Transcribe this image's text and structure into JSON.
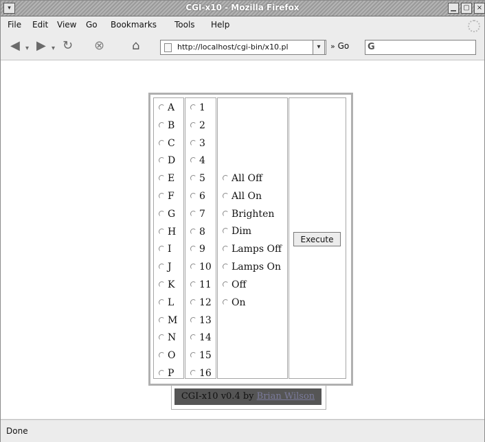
{
  "window": {
    "title": "CGI-x10 - Mozilla Firefox"
  },
  "menubar": {
    "items": [
      {
        "label": "File"
      },
      {
        "label": "Edit"
      },
      {
        "label": "View"
      },
      {
        "label": "Go"
      },
      {
        "label": "Bookmarks"
      },
      {
        "label": "Tools"
      },
      {
        "label": "Help"
      }
    ]
  },
  "navbar": {
    "url": "http://localhost/cgi-bin/x10.pl",
    "go_label": "Go",
    "icons": [
      "back-icon",
      "forward-icon",
      "reload-icon",
      "stop-icon",
      "home-icon"
    ]
  },
  "form": {
    "house_codes": [
      "A",
      "B",
      "C",
      "D",
      "E",
      "F",
      "G",
      "H",
      "I",
      "J",
      "K",
      "L",
      "M",
      "N",
      "O",
      "P"
    ],
    "unit_codes": [
      "1",
      "2",
      "3",
      "4",
      "5",
      "6",
      "7",
      "8",
      "9",
      "10",
      "11",
      "12",
      "13",
      "14",
      "15",
      "16"
    ],
    "commands": [
      "All Off",
      "All On",
      "Brighten",
      "Dim",
      "Lamps Off",
      "Lamps On",
      "Off",
      "On"
    ],
    "execute_label": "Execute"
  },
  "footer": {
    "prefix": "CGI-x10 v0.4 by ",
    "author": "Brian Wilson"
  },
  "status": {
    "text": "Done"
  },
  "colors": {
    "footer_bg": "#555555",
    "link": "#7a7a9a",
    "chrome": "#ececec"
  }
}
